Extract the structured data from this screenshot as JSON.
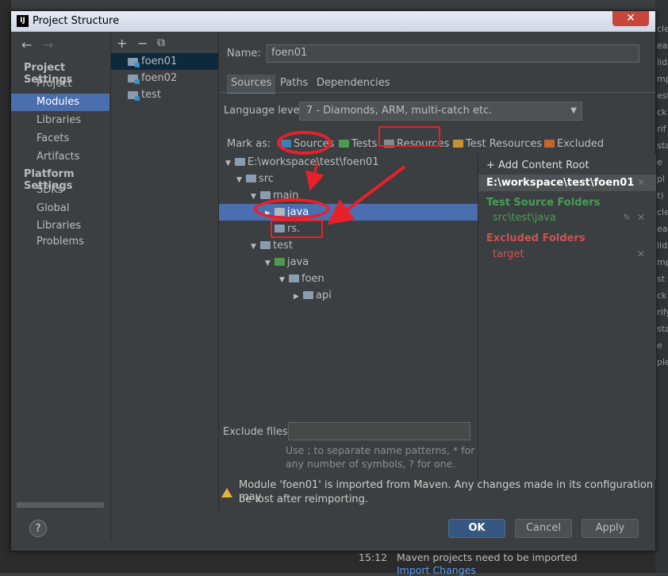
{
  "window": {
    "title": "Project Structure",
    "app_icon": "IJ"
  },
  "nav": {
    "project_settings_header": "Project Settings",
    "platform_settings_header": "Platform Settings",
    "items": [
      {
        "label": "Project"
      },
      {
        "label": "Modules",
        "selected": true
      },
      {
        "label": "Libraries"
      },
      {
        "label": "Facets"
      },
      {
        "label": "Artifacts"
      }
    ],
    "platform_items": [
      {
        "label": "SDKs"
      },
      {
        "label": "Global Libraries"
      }
    ],
    "problems": "Problems"
  },
  "modules": {
    "toolbar": {
      "add": "+",
      "remove": "−",
      "copy": "⧉"
    },
    "items": [
      {
        "label": "foen01",
        "selected": true
      },
      {
        "label": "foen02"
      },
      {
        "label": "test"
      }
    ]
  },
  "name_field": {
    "label": "Name:",
    "value": "foen01"
  },
  "tabs": [
    {
      "label": "Sources",
      "selected": true
    },
    {
      "label": "Paths"
    },
    {
      "label": "Dependencies"
    }
  ],
  "language_level": {
    "label": "Language level:",
    "value": "7 - Diamonds, ARM, multi-catch etc."
  },
  "mark_as": {
    "label": "Mark as:",
    "items": [
      {
        "label": "Sources",
        "color": "#3d7fb5"
      },
      {
        "label": "Tests",
        "color": "#4e9a4e"
      },
      {
        "label": "Resources",
        "color": "#8a8a8a"
      },
      {
        "label": "Test Resources",
        "color": "#c7922e"
      },
      {
        "label": "Excluded",
        "color": "#c6642b"
      }
    ]
  },
  "tree": [
    {
      "label": "E:\\workspace\\test\\foen01",
      "depth": 0,
      "expanded": true
    },
    {
      "label": "src",
      "depth": 1,
      "expanded": true
    },
    {
      "label": "main",
      "depth": 2,
      "expanded": true
    },
    {
      "label": "java",
      "depth": 3,
      "selected": true,
      "collapsed": true
    },
    {
      "label": "rs.",
      "depth": 3
    },
    {
      "label": "test",
      "depth": 2,
      "expanded": true
    },
    {
      "label": "java",
      "depth": 3,
      "expanded": true,
      "kind": "test"
    },
    {
      "label": "foen",
      "depth": 4,
      "expanded": true
    },
    {
      "label": "api",
      "depth": 5,
      "collapsed": true
    }
  ],
  "content_roots": {
    "add_label": "+ Add Content Root",
    "root_path": "E:\\workspace\\test\\foen01",
    "test_source_header": "Test Source Folders",
    "test_source_path": "src\\test\\java",
    "excluded_header": "Excluded Folders",
    "excluded_path": "target",
    "colors": {
      "test": "#499c54",
      "excluded": "#c75450"
    }
  },
  "exclude_files": {
    "label": "Exclude files:",
    "value": "",
    "hint_line1": "Use ; to separate name patterns, * for",
    "hint_line2": "any number of symbols, ? for one."
  },
  "warning": {
    "line1": "Module 'foen01' is imported from Maven. Any changes made in its configuration may",
    "line2": "be lost after reimporting."
  },
  "buttons": {
    "ok": "OK",
    "cancel": "Cancel",
    "apply": "Apply",
    "help": "?"
  },
  "background": {
    "right_fragments": [
      "cle",
      "ean",
      "lid",
      "mp",
      "est",
      "ck",
      "rif",
      "sta",
      "e",
      "pl",
      "t)",
      "cle",
      "ean",
      "lid",
      "mp",
      "st",
      "ck",
      "rify",
      "sta",
      "e",
      "ple"
    ],
    "event_time": "15:12",
    "event_text": "Maven projects need to be imported",
    "event_link": "Import Changes"
  }
}
